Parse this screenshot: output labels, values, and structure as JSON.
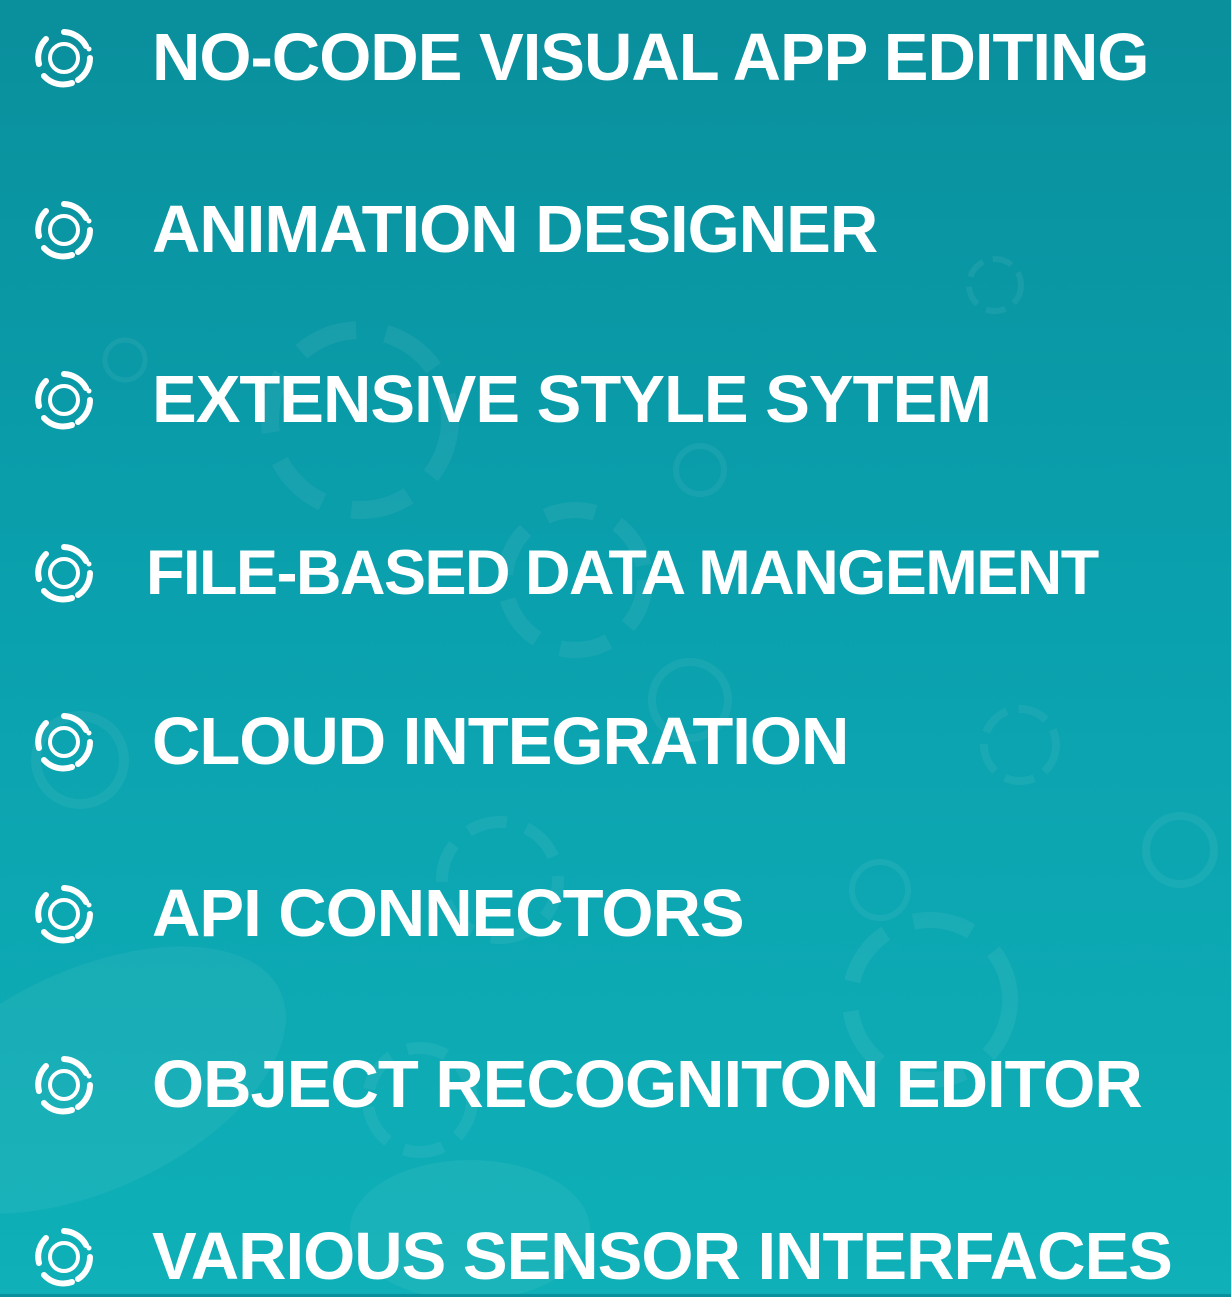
{
  "features": [
    {
      "label": "NO-CODE VISUAL APP EDITING",
      "icon": "target-icon"
    },
    {
      "label": "ANIMATION DESIGNER",
      "icon": "target-icon"
    },
    {
      "label": "EXTENSIVE STYLE SYTEM",
      "icon": "target-icon"
    },
    {
      "label": "FILE-BASED DATA MANGEMENT",
      "icon": "target-icon"
    },
    {
      "label": "CLOUD INTEGRATION",
      "icon": "target-icon"
    },
    {
      "label": "API CONNECTORS",
      "icon": "target-icon"
    },
    {
      "label": "OBJECT RECOGNITON EDITOR",
      "icon": "target-icon"
    },
    {
      "label": "VARIOUS SENSOR INTERFACES",
      "icon": "target-icon"
    }
  ],
  "colors": {
    "background": "#0aa0ad",
    "text": "#ffffff",
    "icon": "#ffffff"
  }
}
